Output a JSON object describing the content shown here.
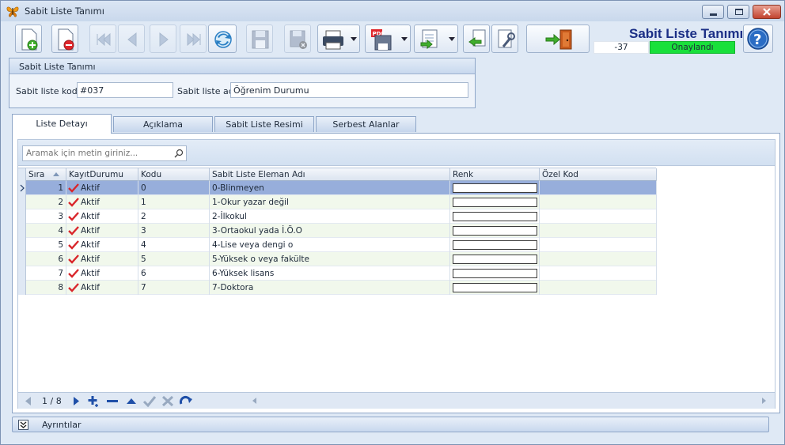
{
  "window": {
    "title": "Sabit Liste Tanımı"
  },
  "header": {
    "form_title": "Sabit Liste Tanımı",
    "record_number": "-37",
    "status": "Onaylandı",
    "status_color": "#19e03b"
  },
  "toolbar": {
    "icons": [
      "new-record-icon",
      "delete-record-icon",
      "first-record-icon",
      "previous-record-icon",
      "next-record-icon",
      "last-record-icon",
      "refresh-icon",
      "save-icon",
      "cancel-save-icon",
      "print-icon",
      "pdf-export-icon",
      "export-icon",
      "import-icon",
      "tools-icon",
      "exit-icon",
      "help-icon"
    ]
  },
  "group": {
    "title": "Sabit Liste Tanımı",
    "code_label": "Sabit liste kodu",
    "code_value": "#037",
    "name_label": "Sabit liste adı",
    "name_value": "Öğrenim Durumu"
  },
  "tabs": [
    {
      "label": "Liste Detayı",
      "active": true
    },
    {
      "label": "Açıklama",
      "active": false
    },
    {
      "label": "Sabit Liste Resimi",
      "active": false
    },
    {
      "label": "Serbest Alanlar",
      "active": false
    }
  ],
  "search": {
    "placeholder": "Aramak için metin giriniz..."
  },
  "grid": {
    "columns": [
      "Sıra",
      "KayıtDurumu",
      "Kodu",
      "Sabit Liste Eleman Adı",
      "Renk",
      "Özel Kod"
    ],
    "rows": [
      {
        "sira": "1",
        "durum": "Aktif",
        "kodu": "0",
        "ad": "0-Blinmeyen",
        "ozel": ""
      },
      {
        "sira": "2",
        "durum": "Aktif",
        "kodu": "1",
        "ad": "1-Okur yazar değil",
        "ozel": ""
      },
      {
        "sira": "3",
        "durum": "Aktif",
        "kodu": "2",
        "ad": "2-İlkokul",
        "ozel": ""
      },
      {
        "sira": "4",
        "durum": "Aktif",
        "kodu": "3",
        "ad": "3-Ortaokul yada İ.Ö.O",
        "ozel": ""
      },
      {
        "sira": "5",
        "durum": "Aktif",
        "kodu": "4",
        "ad": "4-Lise veya dengi o",
        "ozel": ""
      },
      {
        "sira": "6",
        "durum": "Aktif",
        "kodu": "5",
        "ad": "5-Yüksek o veya fakülte",
        "ozel": ""
      },
      {
        "sira": "7",
        "durum": "Aktif",
        "kodu": "6",
        "ad": "6-Yüksek lisans",
        "ozel": ""
      },
      {
        "sira": "8",
        "durum": "Aktif",
        "kodu": "7",
        "ad": "7-Doktora",
        "ozel": ""
      }
    ],
    "selected_row": 0,
    "check_color": "#d9262b",
    "selection_color": "#97aedb"
  },
  "navigator": {
    "position": "1 / 8"
  },
  "details": {
    "label": "Ayrıntılar"
  }
}
